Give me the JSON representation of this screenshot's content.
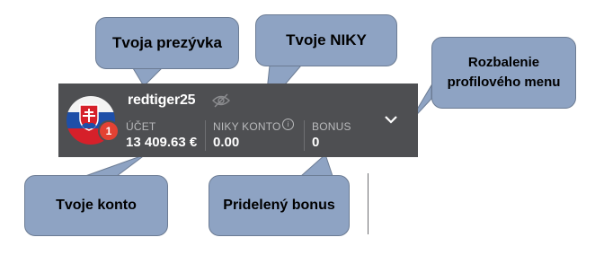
{
  "profile": {
    "username": "redtiger25",
    "notification_count": "1",
    "account": {
      "label": "ÚČET",
      "value": "13 409.63 €"
    },
    "niky": {
      "label": "NIKY KONTO",
      "value": "0.00",
      "info_glyph": "i"
    },
    "bonus": {
      "label": "BONUS",
      "value": "0"
    },
    "icons": [
      "slovak-flag-avatar",
      "eye-off-icon",
      "info-icon",
      "chevron-down-icon"
    ]
  },
  "callouts": {
    "prezyvka": "Tvoja prezývka",
    "niky": "Tvoje NIKY",
    "menu_line1": "Rozbalenie",
    "menu_line2": "profilového menu",
    "konto": "Tvoje konto",
    "bonus": "Pridelený bonus"
  },
  "colors": {
    "bar_bg": "#4e4f52",
    "callout_bg": "#8ea3c3",
    "badge": "#e34233"
  }
}
